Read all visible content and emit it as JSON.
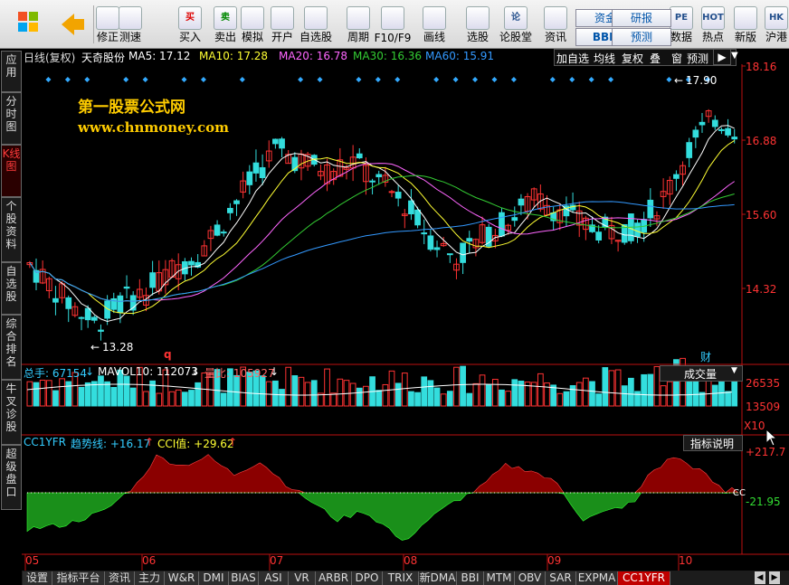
{
  "toolbar": {
    "buttons": [
      {
        "label": "修正",
        "icon": "arrow-up-down-icon"
      },
      {
        "label": "测速",
        "icon": "speedometer-icon"
      },
      {
        "label": "买入",
        "icon": "buy-icon",
        "glyph": "买"
      },
      {
        "label": "卖出",
        "icon": "sell-icon",
        "glyph": "卖"
      },
      {
        "label": "模拟",
        "icon": "hammer-icon"
      },
      {
        "label": "开户",
        "icon": "lock-icon"
      },
      {
        "label": "自选股",
        "icon": "star-icon"
      },
      {
        "label": "周期",
        "icon": "clock-icon"
      },
      {
        "label": "F10/F9",
        "icon": "document-icon"
      },
      {
        "label": "画线",
        "icon": "pencil-icon"
      },
      {
        "label": "选股",
        "icon": "screen-icon"
      },
      {
        "label": "论股堂",
        "icon": "forum-icon",
        "glyph": "论"
      },
      {
        "label": "资讯",
        "icon": "news-icon"
      },
      {
        "label": "数据",
        "icon": "pe-icon",
        "glyph": "PE"
      },
      {
        "label": "热点",
        "icon": "hot-icon",
        "glyph": "HOT"
      },
      {
        "label": "新版",
        "icon": "new-version-icon"
      },
      {
        "label": "沪港",
        "icon": "hk-icon",
        "glyph": "HK"
      }
    ],
    "small_buttons": {
      "zijin": "资金",
      "bbd": "BBD",
      "yanbao": "研报",
      "yuce": "预测"
    }
  },
  "left_tabs": [
    "应用",
    "分时图",
    "K线图",
    "个股资料",
    "自选股",
    "综合排名",
    "牛叉诊股",
    "超级盘口"
  ],
  "header": {
    "mode": "日线(复权)",
    "stock": "天奇股份",
    "ma5": "MA5: 17.12",
    "ma10": "MA10: 17.28",
    "ma20": "MA20: 16.78",
    "ma30": "MA30: 16.36",
    "ma60": "MA60: 15.91",
    "buttons": [
      "加自选",
      "均线",
      "复权",
      "叠",
      "窗",
      "预测"
    ]
  },
  "watermark": {
    "name": "第一股票公式网",
    "url": "www.chnmoney.com"
  },
  "colors": {
    "up": "#ff3333",
    "down": "#33dddd",
    "ma5": "#ffffff",
    "ma10": "#ffff33",
    "ma20": "#ff66ff",
    "ma30": "#33cc33",
    "ma60": "#3399ff",
    "axis": "#bb1111"
  },
  "price_axis": [
    "18.16",
    "16.88",
    "15.60",
    "14.32"
  ],
  "price_annotations": {
    "high": "17.90",
    "low": "13.28",
    "event_q": "q",
    "event_cai": "财"
  },
  "volume_header": {
    "total": "总手: 67154",
    "mavol": "MAVOL10: 112073",
    "ratio": "量比: 105927",
    "select": "成交量"
  },
  "volume_axis": [
    "26535",
    "13509",
    "X10"
  ],
  "cci_header": {
    "name": "CC1YFR",
    "trend": "趋势线: +16.17",
    "cci": "CCI值: +29.62",
    "help": "指标说明"
  },
  "cci_axis": [
    "+217.7",
    "-21.95"
  ],
  "cci_tag": "CC",
  "x_axis": [
    "05",
    "06",
    "07",
    "08",
    "09",
    "10"
  ],
  "bottom_tabs": [
    "设置",
    "指标平台",
    "资讯",
    "主力",
    "W&R",
    "DMI",
    "BIAS",
    "ASI",
    "VR",
    "ARBR",
    "DPO",
    "TRIX",
    "新DMA",
    "BBI",
    "MTM",
    "OBV",
    "SAR",
    "EXPMA",
    "CC1YFR"
  ]
}
